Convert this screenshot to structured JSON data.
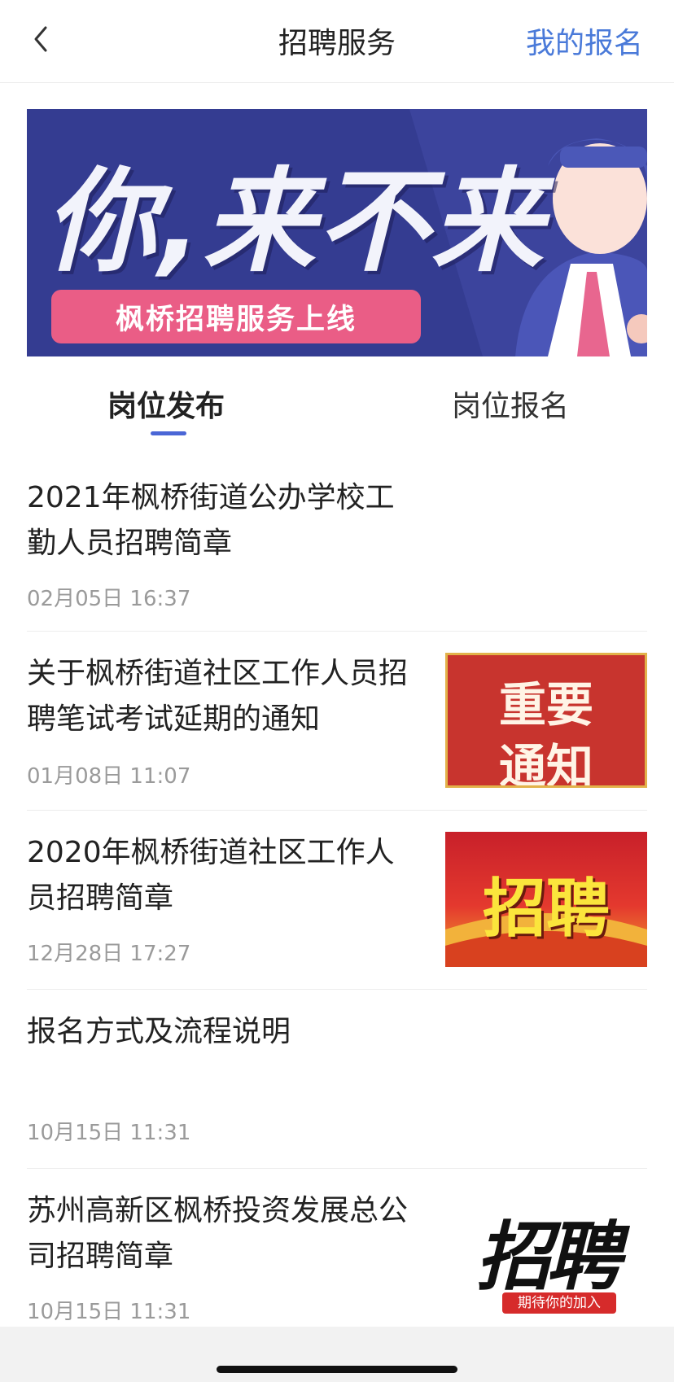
{
  "nav": {
    "title": "招聘服务",
    "action": "我的报名"
  },
  "banner": {
    "headline": "你,来不来",
    "pill": "枫桥招聘服务上线"
  },
  "tabs": [
    {
      "label": "岗位发布",
      "active": true
    },
    {
      "label": "岗位报名",
      "active": false
    }
  ],
  "list": [
    {
      "title": "2021年枫桥街道公办学校工勤人员招聘简章",
      "date": "02月05日 16:37"
    },
    {
      "title": "关于枫桥街道社区工作人员招聘笔试考试延期的通知",
      "date": "01月08日 11:07",
      "thumb_line1": "重要",
      "thumb_line2": "通知"
    },
    {
      "title": "2020年枫桥街道社区工作人员招聘简章",
      "date": "12月28日 17:27",
      "thumb_text": "招聘"
    },
    {
      "title": "报名方式及流程说明",
      "date": "10月15日 11:31"
    },
    {
      "title": "苏州高新区枫桥投资发展总公司招聘简章",
      "date": "10月15日 11:31",
      "thumb_text": "招聘",
      "thumb_sub": "期待你的加入"
    }
  ],
  "colors": {
    "accent": "#4a7ad9",
    "tab_indicator": "#4a66d6",
    "banner_bg": "#343c91",
    "banner_pill": "#ea5d86"
  }
}
